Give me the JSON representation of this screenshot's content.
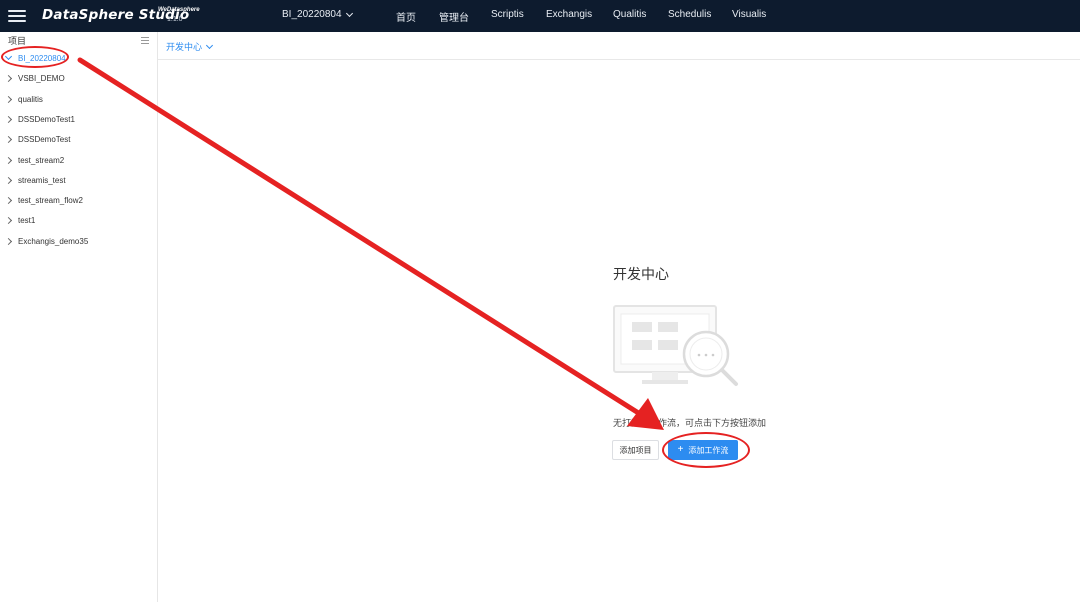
{
  "header": {
    "logo": "DataSphere Studio",
    "brand_sup": "WeDatasphere",
    "version": "1.1.0",
    "current_project": "BI_20220804",
    "nav": [
      {
        "label": "首页"
      },
      {
        "label": "管理台"
      },
      {
        "label": "Scriptis"
      },
      {
        "label": "Exchangis"
      },
      {
        "label": "Qualitis"
      },
      {
        "label": "Schedulis"
      },
      {
        "label": "Visualis"
      }
    ]
  },
  "sidebar": {
    "title": "项目",
    "items": [
      {
        "label": "BI_20220804",
        "expanded": true
      },
      {
        "label": "VSBI_DEMO"
      },
      {
        "label": "qualitis"
      },
      {
        "label": "DSSDemoTest1"
      },
      {
        "label": "DSSDemoTest"
      },
      {
        "label": "test_stream2"
      },
      {
        "label": "streamis_test"
      },
      {
        "label": "test_stream_flow2"
      },
      {
        "label": "test1"
      },
      {
        "label": "Exchangis_demo35"
      }
    ]
  },
  "tabbar": {
    "active_tab": "开发中心"
  },
  "empty_state": {
    "title": "开发中心",
    "message": "无打开的工作流，可点击下方按钮添加",
    "add_project_label": "添加项目",
    "add_workflow_label": "添加工作流"
  },
  "colors": {
    "topbar": "#0d1b2e",
    "accent": "#2d8cf0",
    "annotation": "#e52222"
  }
}
